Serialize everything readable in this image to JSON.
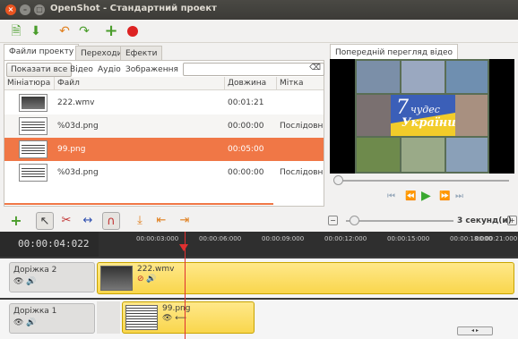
{
  "window": {
    "title": "OpenShot - Стандартний проект",
    "close_glyph": "×",
    "min_glyph": "–",
    "max_glyph": "□"
  },
  "toolbar": {
    "icons": [
      "new-project-icon",
      "save-icon",
      "undo-icon",
      "redo-icon",
      "add-icon",
      "record-icon"
    ]
  },
  "tabs": [
    {
      "label": "Файли проекту",
      "active": true
    },
    {
      "label": "Переходи",
      "active": false
    },
    {
      "label": "Ефекти",
      "active": false
    }
  ],
  "filter": {
    "show_all": "Показати все",
    "video": "Відео",
    "audio": "Аудіо",
    "images": "Зображення",
    "search_value": "",
    "clear_glyph": "⌫"
  },
  "columns": {
    "thumb": "Мініатюра",
    "file": "Файл",
    "length": "Довжина",
    "label": "Мітка"
  },
  "files": [
    {
      "name": "222.wmv",
      "length": "00:01:21",
      "label": "",
      "selected": false,
      "kind": "video"
    },
    {
      "name": "%03d.png",
      "length": "00:00:00",
      "label": "Послідовн",
      "selected": false,
      "kind": "image"
    },
    {
      "name": "99.png",
      "length": "00:05:00",
      "label": "",
      "selected": true,
      "kind": "image"
    },
    {
      "name": "%03d.png",
      "length": "00:00:00",
      "label": "Послідовн",
      "selected": false,
      "kind": "image"
    }
  ],
  "preview": {
    "tab_label": "Попередній перегляд відео",
    "logo_line1": "чудес",
    "logo_line2": "України",
    "logo_num": "7",
    "progress": 0.02
  },
  "playback": {
    "rewind_start": "⏮",
    "rewind": "⏪",
    "play": "▶",
    "forward": "⏩",
    "forward_end": "⏭"
  },
  "timeline": {
    "timecode": "00:00:04:022",
    "zoom_label": "3 секунд(и)",
    "zoom_level": 0.03,
    "ticks": [
      "00:00:03:000",
      "00:00:06:000",
      "00:00:09:000",
      "00:00:12:000",
      "00:00:15:000",
      "00:00:18:000",
      "00:00:21:000"
    ],
    "tracks": [
      {
        "name": "Доріжка 2",
        "clip": "222.wmv"
      },
      {
        "name": "Доріжка 1",
        "clip": "99.png"
      }
    ]
  },
  "colors": {
    "accent": "#f07746",
    "clip": "#f9d64c",
    "playhead": "#e03030"
  }
}
